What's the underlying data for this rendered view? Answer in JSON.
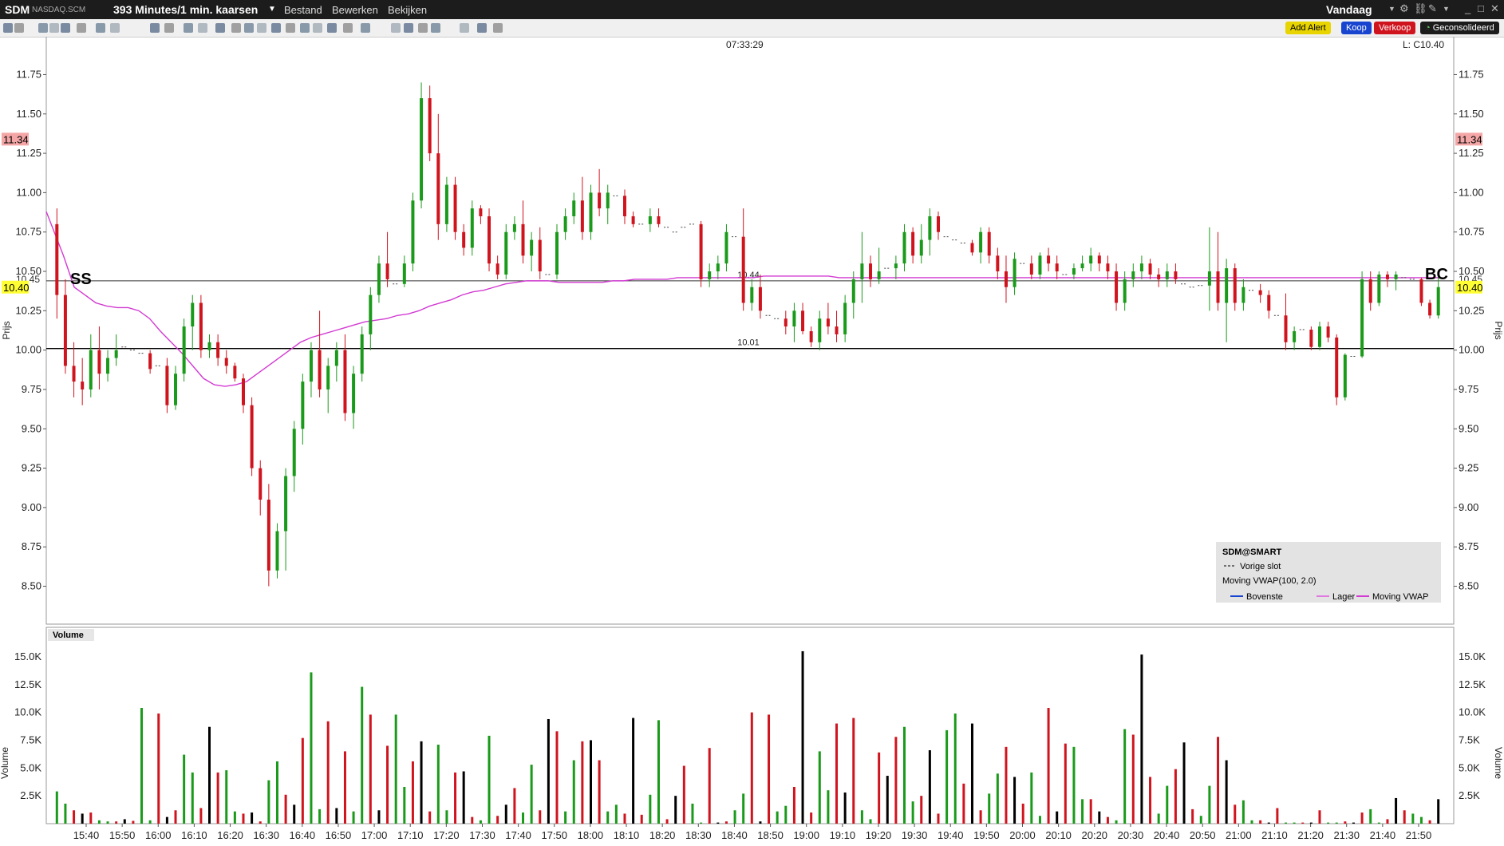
{
  "titlebar": {
    "symbol": "SDM",
    "exchange": "NASDAQ.SCM",
    "timeframe": "393 Minutes/1 min. kaarsen",
    "menu": [
      "Bestand",
      "Bewerken",
      "Bekijken"
    ],
    "period": "Vandaag"
  },
  "toolbar": {
    "add_alert": "Add Alert",
    "buy": "Koop",
    "sell": "Verkoop",
    "consolidated": "Geconsolideerd"
  },
  "colors": {
    "up": "#1a9a1a",
    "down": "#d0141e",
    "vwap": "#d23ad2",
    "last_price_bg": "#ffff33",
    "high_bg": "#f4a6a6"
  },
  "chart_data": {
    "type": "candlestick",
    "time_label": "07:33:29",
    "ohlc_label": "L: C10.40",
    "y_axis": {
      "label": "Prijs",
      "ylim": [
        8.3,
        11.95
      ],
      "ticks": [
        "8.50",
        "8.75",
        "9.00",
        "9.25",
        "9.50",
        "9.75",
        "10.00",
        "10.25",
        "10.50",
        "10.75",
        "11.00",
        "11.25",
        "11.50",
        "11.75"
      ]
    },
    "price_tags": {
      "high": "11.34",
      "last": "10.40",
      "upper": "10.45"
    },
    "hlines": [
      {
        "value": 10.01,
        "label": "10.01"
      },
      {
        "value": 10.44,
        "label": "10.44"
      }
    ],
    "markers": {
      "left": "SS",
      "right": "BC"
    },
    "x_axis": {
      "labels": [
        "15:40",
        "15:50",
        "16:00",
        "16:10",
        "16:20",
        "16:30",
        "16:40",
        "16:50",
        "17:00",
        "17:10",
        "17:20",
        "17:30",
        "17:40",
        "17:50",
        "18:00",
        "18:10",
        "18:20",
        "18:30",
        "18:40",
        "18:50",
        "19:00",
        "19:10",
        "19:20",
        "19:30",
        "19:40",
        "19:50",
        "20:00",
        "20:10",
        "20:20",
        "20:30",
        "20:40",
        "20:50",
        "21:00",
        "21:10",
        "21:20",
        "21:30",
        "21:40",
        "21:50"
      ]
    },
    "candles": [
      [
        10.8,
        10.9,
        10.2,
        10.35
      ],
      [
        10.35,
        10.45,
        9.85,
        9.9
      ],
      [
        9.9,
        10.05,
        9.7,
        9.8
      ],
      [
        9.8,
        9.95,
        9.65,
        9.75
      ],
      [
        9.75,
        10.1,
        9.7,
        10.0
      ],
      [
        10.0,
        10.15,
        9.75,
        9.85
      ],
      [
        9.85,
        10.0,
        9.8,
        9.95
      ],
      [
        9.95,
        10.1,
        9.9,
        10.0
      ],
      [
        10.0,
        10.05,
        9.95,
        10.02
      ],
      [
        10.02,
        10.08,
        9.98,
        10.0
      ],
      [
        10.0,
        10.05,
        9.95,
        9.98
      ],
      [
        9.98,
        10.0,
        9.85,
        9.88
      ],
      [
        9.88,
        9.95,
        9.85,
        9.9
      ],
      [
        9.9,
        9.95,
        9.6,
        9.65
      ],
      [
        9.65,
        9.9,
        9.62,
        9.85
      ],
      [
        9.85,
        10.2,
        9.8,
        10.15
      ],
      [
        10.15,
        10.35,
        10.0,
        10.3
      ],
      [
        10.3,
        10.35,
        9.95,
        10.0
      ],
      [
        10.0,
        10.1,
        9.95,
        10.05
      ],
      [
        10.05,
        10.1,
        9.9,
        9.95
      ],
      [
        9.95,
        10.0,
        9.85,
        9.9
      ],
      [
        9.9,
        9.92,
        9.8,
        9.82
      ],
      [
        9.82,
        9.85,
        9.6,
        9.65
      ],
      [
        9.65,
        9.7,
        9.2,
        9.25
      ],
      [
        9.25,
        9.3,
        8.95,
        9.05
      ],
      [
        9.05,
        9.15,
        8.5,
        8.6
      ],
      [
        8.6,
        8.9,
        8.55,
        8.85
      ],
      [
        8.85,
        9.25,
        8.6,
        9.2
      ],
      [
        9.2,
        9.55,
        9.1,
        9.5
      ],
      [
        9.5,
        9.85,
        9.4,
        9.8
      ],
      [
        9.8,
        10.05,
        9.7,
        10.0
      ],
      [
        10.0,
        10.25,
        9.7,
        9.75
      ],
      [
        9.75,
        9.95,
        9.6,
        9.9
      ],
      [
        9.9,
        10.05,
        9.8,
        10.0
      ],
      [
        10.0,
        10.1,
        9.55,
        9.6
      ],
      [
        9.6,
        9.9,
        9.5,
        9.85
      ],
      [
        9.85,
        10.15,
        9.8,
        10.1
      ],
      [
        10.1,
        10.4,
        10.0,
        10.35
      ],
      [
        10.35,
        10.6,
        10.3,
        10.55
      ],
      [
        10.55,
        10.75,
        10.4,
        10.45
      ],
      [
        10.45,
        10.5,
        10.38,
        10.42
      ],
      [
        10.42,
        10.6,
        10.4,
        10.55
      ],
      [
        10.55,
        11.0,
        10.5,
        10.95
      ],
      [
        10.95,
        11.7,
        10.9,
        11.6
      ],
      [
        11.6,
        11.68,
        11.2,
        11.25
      ],
      [
        11.25,
        11.5,
        10.7,
        10.8
      ],
      [
        10.8,
        11.1,
        10.75,
        11.05
      ],
      [
        11.05,
        11.1,
        10.7,
        10.75
      ],
      [
        10.75,
        10.8,
        10.6,
        10.65
      ],
      [
        10.65,
        10.95,
        10.6,
        10.9
      ],
      [
        10.9,
        10.92,
        10.8,
        10.85
      ],
      [
        10.85,
        10.9,
        10.5,
        10.55
      ],
      [
        10.55,
        10.6,
        10.45,
        10.48
      ],
      [
        10.48,
        10.8,
        10.45,
        10.75
      ],
      [
        10.75,
        10.85,
        10.7,
        10.8
      ],
      [
        10.8,
        10.95,
        10.55,
        10.6
      ],
      [
        10.6,
        10.75,
        10.5,
        10.7
      ],
      [
        10.7,
        10.78,
        10.45,
        10.5
      ],
      [
        10.5,
        10.55,
        10.45,
        10.48
      ],
      [
        10.48,
        10.8,
        10.45,
        10.75
      ],
      [
        10.75,
        10.9,
        10.7,
        10.85
      ],
      [
        10.85,
        11.0,
        10.8,
        10.95
      ],
      [
        10.95,
        11.1,
        10.7,
        10.75
      ],
      [
        10.75,
        11.05,
        10.7,
        11.0
      ],
      [
        11.0,
        11.15,
        10.85,
        10.9
      ],
      [
        10.9,
        11.05,
        10.8,
        11.0
      ],
      [
        11.0,
        11.05,
        10.95,
        10.98
      ],
      [
        10.98,
        11.02,
        10.8,
        10.85
      ],
      [
        10.85,
        10.88,
        10.78,
        10.8
      ],
      [
        10.8,
        10.85,
        10.75,
        10.8
      ],
      [
        10.8,
        10.9,
        10.75,
        10.85
      ],
      [
        10.85,
        10.9,
        10.78,
        10.8
      ],
      [
        10.8,
        10.85,
        10.75,
        10.78
      ],
      [
        10.78,
        10.85,
        10.7,
        10.75
      ],
      [
        10.75,
        10.8,
        10.7,
        10.78
      ],
      [
        10.78,
        11.0,
        10.75,
        10.8
      ],
      [
        10.8,
        10.82,
        10.4,
        10.45
      ],
      [
        10.45,
        10.55,
        10.4,
        10.5
      ],
      [
        10.5,
        10.6,
        10.45,
        10.55
      ],
      [
        10.55,
        10.8,
        10.5,
        10.75
      ],
      [
        10.75,
        10.8,
        10.7,
        10.72
      ],
      [
        10.72,
        10.9,
        10.25,
        10.3
      ],
      [
        10.3,
        10.45,
        10.25,
        10.4
      ],
      [
        10.4,
        10.48,
        10.2,
        10.25
      ],
      [
        10.25,
        10.3,
        10.2,
        10.22
      ],
      [
        10.22,
        10.25,
        10.18,
        10.2
      ],
      [
        10.2,
        10.25,
        10.1,
        10.15
      ],
      [
        10.15,
        10.3,
        10.05,
        10.25
      ],
      [
        10.25,
        10.3,
        10.1,
        10.12
      ],
      [
        10.12,
        10.15,
        10.02,
        10.05
      ],
      [
        10.05,
        10.25,
        10.0,
        10.2
      ],
      [
        10.2,
        10.3,
        10.1,
        10.15
      ],
      [
        10.15,
        10.25,
        10.05,
        10.1
      ],
      [
        10.1,
        10.35,
        10.05,
        10.3
      ],
      [
        10.3,
        10.5,
        10.2,
        10.45
      ],
      [
        10.45,
        10.75,
        10.3,
        10.55
      ],
      [
        10.55,
        10.6,
        10.4,
        10.45
      ],
      [
        10.45,
        10.65,
        10.42,
        10.5
      ],
      [
        10.5,
        10.55,
        10.48,
        10.52
      ],
      [
        10.52,
        10.6,
        10.45,
        10.55
      ],
      [
        10.55,
        10.8,
        10.5,
        10.75
      ],
      [
        10.75,
        10.78,
        10.55,
        10.6
      ],
      [
        10.6,
        10.8,
        10.55,
        10.7
      ],
      [
        10.7,
        10.9,
        10.6,
        10.85
      ],
      [
        10.85,
        10.88,
        10.7,
        10.75
      ],
      [
        10.75,
        10.82,
        10.7,
        10.72
      ],
      [
        10.72,
        10.75,
        10.68,
        10.7
      ],
      [
        10.7,
        10.72,
        10.65,
        10.68
      ],
      [
        10.68,
        10.7,
        10.6,
        10.62
      ],
      [
        10.62,
        10.78,
        10.55,
        10.75
      ],
      [
        10.75,
        10.78,
        10.55,
        10.6
      ],
      [
        10.6,
        10.65,
        10.45,
        10.5
      ],
      [
        10.5,
        10.6,
        10.3,
        10.4
      ],
      [
        10.4,
        10.62,
        10.35,
        10.58
      ],
      [
        10.58,
        10.6,
        10.5,
        10.55
      ],
      [
        10.55,
        10.6,
        10.45,
        10.48
      ],
      [
        10.48,
        10.62,
        10.45,
        10.6
      ],
      [
        10.6,
        10.65,
        10.5,
        10.55
      ],
      [
        10.55,
        10.6,
        10.45,
        10.5
      ],
      [
        10.5,
        10.55,
        10.45,
        10.48
      ],
      [
        10.48,
        10.55,
        10.45,
        10.52
      ],
      [
        10.52,
        10.6,
        10.5,
        10.55
      ],
      [
        10.55,
        10.65,
        10.5,
        10.6
      ],
      [
        10.6,
        10.62,
        10.5,
        10.55
      ],
      [
        10.55,
        10.6,
        10.45,
        10.5
      ],
      [
        10.5,
        10.55,
        10.25,
        10.3
      ],
      [
        10.3,
        10.5,
        10.25,
        10.45
      ],
      [
        10.45,
        10.55,
        10.4,
        10.5
      ],
      [
        10.5,
        10.6,
        10.45,
        10.55
      ],
      [
        10.55,
        10.58,
        10.45,
        10.48
      ],
      [
        10.48,
        10.52,
        10.4,
        10.45
      ],
      [
        10.45,
        10.55,
        10.4,
        10.5
      ],
      [
        10.5,
        10.55,
        10.42,
        10.45
      ],
      [
        10.45,
        10.48,
        10.4,
        10.42
      ],
      [
        10.42,
        10.45,
        10.38,
        10.4
      ],
      [
        10.4,
        10.42,
        10.38,
        10.41
      ],
      [
        10.41,
        10.78,
        10.25,
        10.5
      ],
      [
        10.5,
        10.75,
        10.25,
        10.3
      ],
      [
        10.3,
        10.58,
        10.05,
        10.52
      ],
      [
        10.52,
        10.55,
        10.25,
        10.3
      ],
      [
        10.3,
        10.45,
        10.25,
        10.4
      ],
      [
        10.4,
        10.45,
        10.35,
        10.38
      ],
      [
        10.38,
        10.42,
        10.3,
        10.35
      ],
      [
        10.35,
        10.38,
        10.2,
        10.25
      ],
      [
        10.25,
        10.28,
        10.2,
        10.22
      ],
      [
        10.22,
        10.36,
        10.0,
        10.05
      ],
      [
        10.05,
        10.15,
        10.0,
        10.12
      ],
      [
        10.12,
        10.15,
        10.1,
        10.13
      ],
      [
        10.13,
        10.15,
        10.0,
        10.02
      ],
      [
        10.02,
        10.18,
        10.0,
        10.15
      ],
      [
        10.15,
        10.18,
        10.05,
        10.08
      ],
      [
        10.08,
        10.1,
        9.65,
        9.7
      ],
      [
        9.7,
        9.98,
        9.68,
        9.97
      ],
      [
        9.97,
        10.0,
        9.95,
        9.96
      ],
      [
        9.96,
        10.5,
        9.95,
        10.45
      ],
      [
        10.45,
        10.5,
        10.25,
        10.3
      ],
      [
        10.3,
        10.5,
        10.28,
        10.48
      ],
      [
        10.48,
        10.5,
        10.4,
        10.45
      ],
      [
        10.45,
        10.5,
        10.38,
        10.48
      ],
      [
        10.48,
        10.5,
        10.44,
        10.46
      ],
      [
        10.46,
        10.48,
        10.42,
        10.45
      ],
      [
        10.45,
        10.46,
        10.28,
        10.3
      ],
      [
        10.3,
        10.32,
        10.2,
        10.22
      ],
      [
        10.22,
        10.48,
        10.2,
        10.4
      ]
    ],
    "volume": {
      "label": "Volume",
      "ylim": [
        0,
        16500
      ],
      "ticks": [
        "2.5K",
        "5.0K",
        "7.5K",
        "10.0K",
        "12.5K",
        "15.0K"
      ],
      "values": [
        2900,
        1800,
        1200,
        900,
        1000,
        300,
        200,
        200,
        400,
        250,
        10400,
        300,
        9900,
        600,
        1200,
        6200,
        4600,
        1400,
        8700,
        4600,
        4800,
        1100,
        900,
        1000,
        200,
        3900,
        5600,
        2600,
        1700,
        7700,
        13600,
        1300,
        9200,
        1400,
        6500,
        1100,
        12300,
        9800,
        1200,
        7000,
        9800,
        3300,
        5600,
        7400,
        1100,
        7100,
        1200,
        4600,
        4700,
        600,
        300,
        7900,
        700,
        1700,
        3200,
        1000,
        5300,
        1200,
        9400,
        8300,
        1100,
        5700,
        7400,
        7500,
        5700,
        1100,
        1700,
        900,
        9500,
        800,
        2600,
        9300,
        400,
        2500,
        5200,
        1800,
        100,
        6800,
        100,
        200,
        1200,
        2700,
        10000,
        200,
        9800,
        1100,
        1600,
        3300,
        15500,
        1000,
        6500,
        3000,
        9000,
        2800,
        9500,
        1200,
        400,
        6400,
        4300,
        7800,
        8700,
        2000,
        2500,
        6600,
        900,
        8400,
        9900,
        3600,
        9000,
        1200,
        2700,
        4500,
        6900,
        4200,
        1800,
        4600,
        700,
        10400,
        1100,
        7200,
        6900,
        2200,
        2200,
        1100,
        600,
        300,
        8500,
        8000,
        15200,
        4200,
        900,
        3400,
        4900,
        7300,
        1300,
        700,
        3400,
        7800,
        5700,
        1700,
        2100,
        300,
        300,
        100,
        1400,
        100,
        100,
        100,
        100,
        1200,
        100,
        100,
        200,
        100,
        1000,
        1300,
        100,
        400,
        2300,
        1200,
        900,
        600,
        300,
        2200
      ]
    },
    "vwap": [
      10.88,
      10.6,
      10.4,
      10.35,
      10.3,
      10.28,
      10.27,
      10.27,
      10.25,
      10.2,
      10.12,
      10.05,
      9.98,
      9.9,
      9.82,
      9.78,
      9.77,
      9.78,
      9.8,
      9.85,
      9.9,
      9.95,
      10.0,
      10.05,
      10.08,
      10.1,
      10.12,
      10.14,
      10.16,
      10.18,
      10.19,
      10.2,
      10.22,
      10.23,
      10.25,
      10.28,
      10.3,
      10.32,
      10.35,
      10.37,
      10.38,
      10.4,
      10.42,
      10.43,
      10.44,
      10.44,
      10.44,
      10.43,
      10.43,
      10.43,
      10.43,
      10.43,
      10.44,
      10.44,
      10.45,
      10.45,
      10.45,
      10.45,
      10.46,
      10.46,
      10.46,
      10.46,
      10.46,
      10.46,
      10.46,
      10.46,
      10.47,
      10.47,
      10.47,
      10.47,
      10.47,
      10.47,
      10.47,
      10.46,
      10.46,
      10.46,
      10.46,
      10.46,
      10.46,
      10.46,
      10.46,
      10.46,
      10.46,
      10.46,
      10.46,
      10.46,
      10.46,
      10.46,
      10.46,
      10.46,
      10.46,
      10.46,
      10.46,
      10.46,
      10.46,
      10.46,
      10.46,
      10.46,
      10.46,
      10.46,
      10.46,
      10.46,
      10.46,
      10.46,
      10.46,
      10.46,
      10.46,
      10.46,
      10.46,
      10.46,
      10.46,
      10.46,
      10.46,
      10.46,
      10.46,
      10.46,
      10.46,
      10.46,
      10.46,
      10.46,
      10.46,
      10.46,
      10.46,
      10.46,
      10.46,
      10.46,
      10.46,
      10.46,
      10.46,
      10.46
    ],
    "legend": {
      "title": "SDM@SMART",
      "prev_close": "Vorige slot",
      "indicator": "Moving VWAP(100, 2.0)",
      "items": [
        "Bovenste",
        "Lager",
        "Moving VWAP"
      ]
    }
  }
}
